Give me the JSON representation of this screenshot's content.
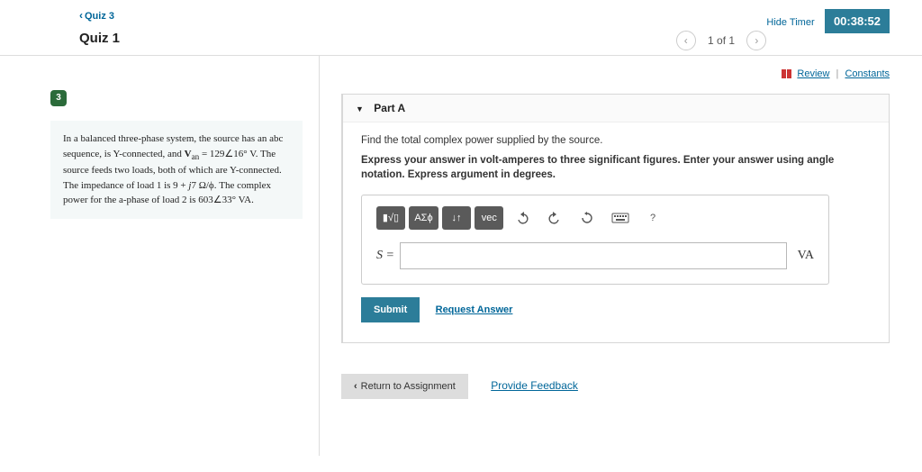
{
  "header": {
    "back_label": "Quiz 3",
    "hide_timer_label": "Hide Timer",
    "timer_value": "00:38:52"
  },
  "title": {
    "quiz_title": "Quiz 1",
    "page_counter": "1 of 1"
  },
  "sidebar": {
    "badge_number": "3",
    "problem_html": "In a balanced three-phase system, the source has an abc sequence, is Y-connected, and 𝐕ₐₙ = 129∠16° V. The source feeds two loads, both of which are Y-connected. The impedance of load 1 is 9 + j7 Ω/ϕ. The complex power for the a-phase of load 2 is 603∠33° VA."
  },
  "tools": {
    "review_label": "Review",
    "constants_label": "Constants"
  },
  "part": {
    "heading": "Part A",
    "instruction1": "Find the total complex power supplied by the source.",
    "instruction2": "Express your answer in volt-amperes to three significant figures. Enter your answer using angle notation. Express argument in degrees.",
    "toolbar": {
      "templates": "▮√▯",
      "symbols": "ΑΣϕ",
      "scripts": "↓↑",
      "vec": "vec",
      "undo_icon": "undo",
      "redo_icon": "redo",
      "reset_icon": "reset",
      "keyboard_icon": "keyboard",
      "help": "?"
    },
    "answer_label": "S =",
    "answer_unit": "VA",
    "submit_label": "Submit",
    "request_answer_label": "Request Answer"
  },
  "footer": {
    "return_label": "Return to Assignment",
    "feedback_label": "Provide Feedback"
  }
}
